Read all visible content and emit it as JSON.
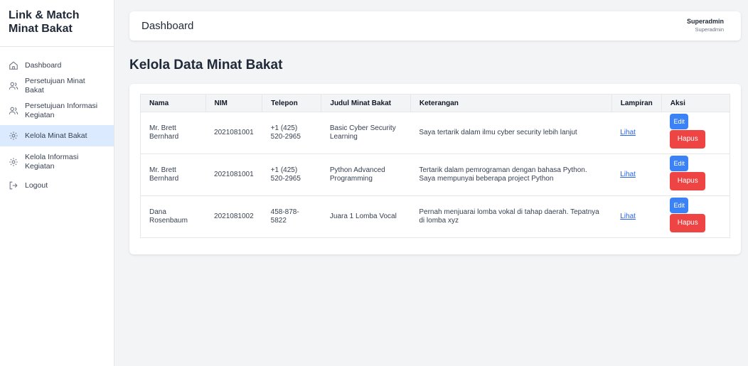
{
  "brand": {
    "line1": "Link & Match",
    "line2": "Minat Bakat"
  },
  "sidebar": {
    "items": [
      {
        "label": "Dashboard",
        "icon": "home-icon"
      },
      {
        "label": "Persetujuan Minat Bakat",
        "icon": "users-icon"
      },
      {
        "label": "Persetujuan Informasi Kegiatan",
        "icon": "users-icon"
      },
      {
        "label": "Kelola Minat Bakat",
        "icon": "gear-icon",
        "active": true
      },
      {
        "label": "Kelola Informasi Kegiatan",
        "icon": "gear-icon"
      },
      {
        "label": "Logout",
        "icon": "logout-icon"
      }
    ]
  },
  "header": {
    "title": "Dashboard",
    "user_name": "Superadmin",
    "user_role": "Superadmin"
  },
  "page": {
    "heading": "Kelola Data Minat Bakat"
  },
  "table": {
    "columns": [
      "Nama",
      "NIM",
      "Telepon",
      "Judul Minat Bakat",
      "Keterangan",
      "Lampiran",
      "Aksi"
    ],
    "rows": [
      {
        "nama": "Mr. Brett Bernhard",
        "nim": "2021081001",
        "telepon": "+1 (425) 520-2965",
        "judul": "Basic Cyber Security Learning",
        "keterangan": "Saya tertarik dalam ilmu cyber security lebih lanjut",
        "lampiran": "Lihat"
      },
      {
        "nama": "Mr. Brett Bernhard",
        "nim": "2021081001",
        "telepon": "+1 (425) 520-2965",
        "judul": "Python Advanced Programming",
        "keterangan": "Tertarik dalam pemrograman dengan bahasa Python. Saya mempunyai beberapa project Python",
        "lampiran": "Lihat"
      },
      {
        "nama": "Dana Rosenbaum",
        "nim": "2021081002",
        "telepon": "458-878-5822",
        "judul": "Juara 1 Lomba Vocal",
        "keterangan": "Pernah menjuarai lomba vokal di tahap daerah. Tepatnya di lomba xyz",
        "lampiran": "Lihat"
      }
    ],
    "actions": {
      "edit": "Edit",
      "delete": "Hapus"
    }
  },
  "colors": {
    "accent": "#3b82f6",
    "danger": "#ef4444",
    "active_nav_bg": "#dbeafe",
    "link": "#2563eb"
  }
}
